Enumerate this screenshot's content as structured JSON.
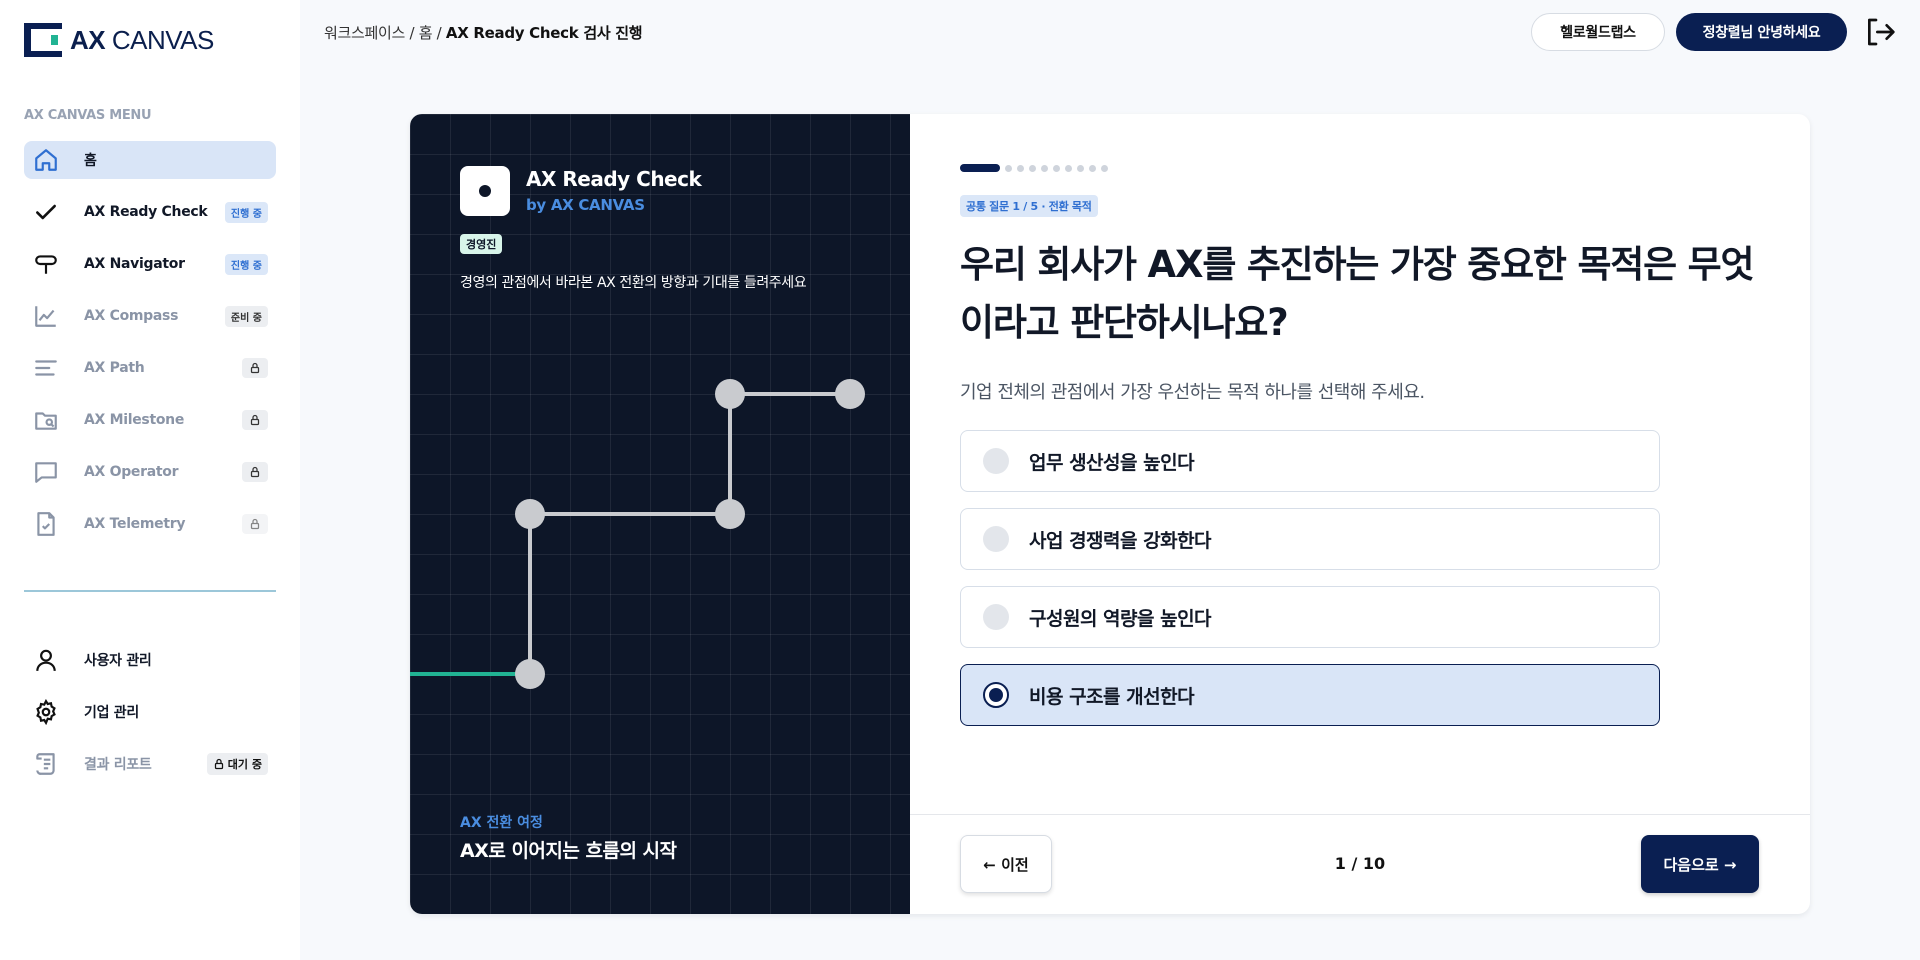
{
  "app": {
    "logo_bold": "AX",
    "logo_light": "CANVAS",
    "accent": "#0a1f52",
    "brand_teal": "#21b393"
  },
  "sidebar": {
    "menu_title": "AX CANVAS MENU",
    "items": [
      {
        "label": "홈",
        "icon": "home-icon",
        "active": true
      },
      {
        "label": "AX Ready Check",
        "icon": "check-icon",
        "badge": "진행 중"
      },
      {
        "label": "AX Navigator",
        "icon": "signpost-icon",
        "badge": "진행 중"
      },
      {
        "label": "AX Compass",
        "icon": "line-chart-icon",
        "badge": "준비 중"
      },
      {
        "label": "AX Path",
        "icon": "lines-icon",
        "badge_icon": "lock-icon"
      },
      {
        "label": "AX Milestone",
        "icon": "folder-search-icon",
        "badge_icon": "lock-icon"
      },
      {
        "label": "AX Operator",
        "icon": "chat-icon",
        "badge_icon": "lock-icon"
      },
      {
        "label": "AX Telemetry",
        "icon": "file-check-icon",
        "badge_icon": "lock-icon"
      }
    ],
    "admin_items": [
      {
        "label": "사용자 관리",
        "icon": "user-icon"
      },
      {
        "label": "기업 관리",
        "icon": "gear-icon"
      },
      {
        "label": "결과 리포트",
        "icon": "scroll-icon",
        "badge": "대기 중"
      }
    ]
  },
  "header": {
    "breadcrumb_prefix": "워크스페이스 / 홈 / ",
    "breadcrumb_current": "AX Ready Check 검사 진행",
    "org_button": "헬로월드랩스",
    "user_button": "정창렬님 안녕하세요"
  },
  "intro": {
    "title": "AX Ready Check",
    "subtitle": "by AX CANVAS",
    "tag": "경영진",
    "description": "경영의 관점에서 바라본 AX 전환의 방향과 기대를 들려주세요",
    "footer_label": "AX 전환 여정",
    "footer_title": "AX로 이어지는 흐름의 시작"
  },
  "question": {
    "progress_current": 1,
    "progress_total": 10,
    "tag": "공통 질문 1 / 5 · 전환 목적",
    "title": "우리 회사가 AX를 추진하는 가장 중요한 목적은 무엇이라고 판단하시나요?",
    "subtitle": "기업 전체의 관점에서 가장 우선하는 목적 하나를 선택해 주세요.",
    "options": [
      {
        "label": "업무 생산성을 높인다",
        "selected": false
      },
      {
        "label": "사업 경쟁력을 강화한다",
        "selected": false
      },
      {
        "label": "구성원의 역량을 높인다",
        "selected": false
      },
      {
        "label": "비용 구조를 개선한다",
        "selected": true
      }
    ]
  },
  "footer": {
    "prev_label": "← 이전",
    "page_indicator": "1 / 10",
    "next_label": "다음으로 →"
  }
}
